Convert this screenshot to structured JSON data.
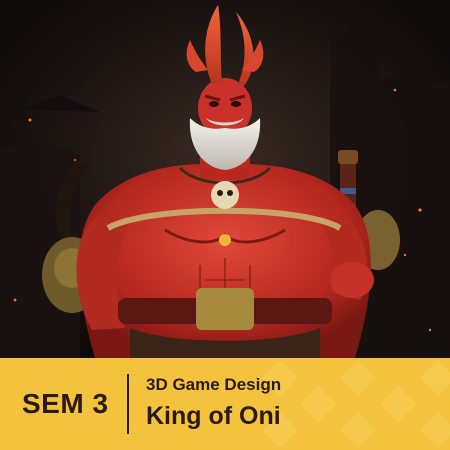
{
  "card": {
    "semester_label": "SEM 3",
    "course_name": "3D Game Design",
    "project_title": "King of Oni"
  },
  "artwork": {
    "subject": "red-oni-warrior-illustration"
  },
  "colors": {
    "banner": "#f4c33d",
    "text": "#2a1a10",
    "skin": "#c8322a",
    "horns": "#d9452c",
    "beard": "#e8e4de",
    "background": "#1a1210"
  }
}
